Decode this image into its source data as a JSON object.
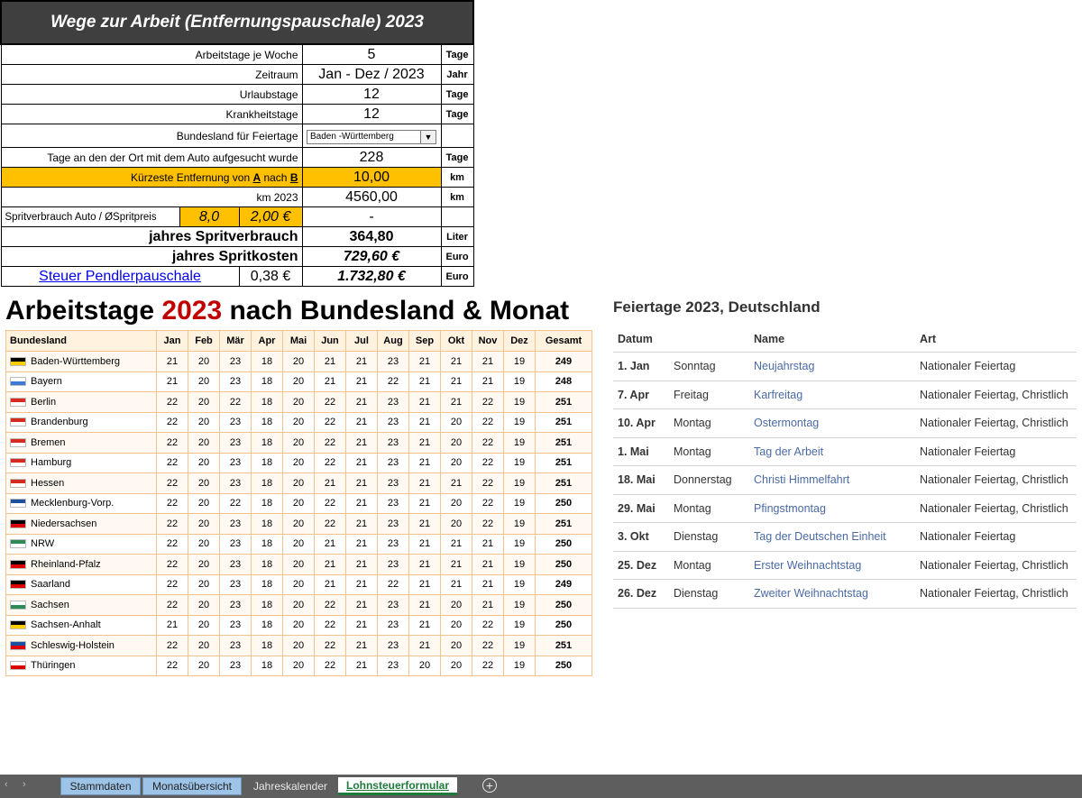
{
  "calc": {
    "title": "Wege zur Arbeit  (Entfernungspauschale)  2023",
    "rows": [
      {
        "label": "Arbeitstage je Woche",
        "value": "5",
        "unit": "Tage"
      },
      {
        "label": "Zeitraum",
        "value": "Jan - Dez / 2023",
        "unit": "Jahr"
      },
      {
        "label": "Urlaubstage",
        "value": "12",
        "unit": "Tage"
      },
      {
        "label": "Krankheitstage",
        "value": "12",
        "unit": "Tage"
      },
      {
        "label": "Bundesland für Feiertage",
        "value": "Baden -Württemberg",
        "unit": ""
      },
      {
        "label": "Tage an den der Ort mit dem Auto aufgesucht wurde",
        "value": "228",
        "unit": "Tage"
      },
      {
        "label_pre": "Kürzeste Entfernung von ",
        "label_a": "A",
        "label_mid": " nach ",
        "label_b": "B",
        "value": "10,00",
        "unit": "km"
      },
      {
        "label": "km 2023",
        "value": "4560,00",
        "unit": "km"
      }
    ],
    "sprit": {
      "label": "Spritverbrauch Auto / ØSpritpreis",
      "verbrauch": "8,0",
      "preis": "2,00 €",
      "value": "-"
    },
    "liter": {
      "label": "jahres Spritverbrauch",
      "value": "364,80",
      "unit": "Liter"
    },
    "kosten": {
      "label": "jahres Spritkosten",
      "value": "729,60 €",
      "unit": "Euro"
    },
    "pendler": {
      "label": "Steuer Pendlerpauschale",
      "rate": "0,38 €",
      "value": "1.732,80 €",
      "unit": "Euro"
    }
  },
  "arbeitstage": {
    "title_pre": "Arbeitstage ",
    "title_year": "2023",
    "title_post": " nach Bundesland & Monat",
    "headers": [
      "Bundesland",
      "Jan",
      "Feb",
      "Mär",
      "Apr",
      "Mai",
      "Jun",
      "Jul",
      "Aug",
      "Sep",
      "Okt",
      "Nov",
      "Dez",
      "Gesamt"
    ],
    "rows": [
      {
        "state": "Baden-Württemberg",
        "flag": [
          "#000000",
          "#ffcc00"
        ],
        "v": [
          "21",
          "20",
          "23",
          "18",
          "20",
          "21",
          "21",
          "23",
          "21",
          "21",
          "21",
          "19",
          "249"
        ]
      },
      {
        "state": "Bayern",
        "flag": [
          "#ffffff",
          "#3a7bd5"
        ],
        "v": [
          "21",
          "20",
          "23",
          "18",
          "20",
          "21",
          "21",
          "22",
          "21",
          "21",
          "21",
          "19",
          "248"
        ]
      },
      {
        "state": "Berlin",
        "flag": [
          "#d52b1e",
          "#ffffff"
        ],
        "v": [
          "22",
          "20",
          "22",
          "18",
          "20",
          "22",
          "21",
          "23",
          "21",
          "21",
          "22",
          "19",
          "251"
        ]
      },
      {
        "state": "Brandenburg",
        "flag": [
          "#d52b1e",
          "#ffffff"
        ],
        "v": [
          "22",
          "20",
          "23",
          "18",
          "20",
          "22",
          "21",
          "23",
          "21",
          "20",
          "22",
          "19",
          "251"
        ]
      },
      {
        "state": "Bremen",
        "flag": [
          "#d52b1e",
          "#ffffff"
        ],
        "v": [
          "22",
          "20",
          "23",
          "18",
          "20",
          "22",
          "21",
          "23",
          "21",
          "20",
          "22",
          "19",
          "251"
        ]
      },
      {
        "state": "Hamburg",
        "flag": [
          "#d52b1e",
          "#ffffff"
        ],
        "v": [
          "22",
          "20",
          "23",
          "18",
          "20",
          "22",
          "21",
          "23",
          "21",
          "20",
          "22",
          "19",
          "251"
        ]
      },
      {
        "state": "Hessen",
        "flag": [
          "#d52b1e",
          "#ffffff"
        ],
        "v": [
          "22",
          "20",
          "23",
          "18",
          "20",
          "21",
          "21",
          "23",
          "21",
          "21",
          "22",
          "19",
          "251"
        ]
      },
      {
        "state": "Mecklenburg-Vorp.",
        "flag": [
          "#1b4fa0",
          "#ffffff"
        ],
        "v": [
          "22",
          "20",
          "22",
          "18",
          "20",
          "22",
          "21",
          "23",
          "21",
          "20",
          "22",
          "19",
          "250"
        ]
      },
      {
        "state": "Niedersachsen",
        "flag": [
          "#000000",
          "#dd0000"
        ],
        "v": [
          "22",
          "20",
          "23",
          "18",
          "20",
          "22",
          "21",
          "23",
          "21",
          "20",
          "22",
          "19",
          "251"
        ]
      },
      {
        "state": "NRW",
        "flag": [
          "#2e8b57",
          "#ffffff"
        ],
        "v": [
          "22",
          "20",
          "23",
          "18",
          "20",
          "21",
          "21",
          "23",
          "21",
          "21",
          "21",
          "19",
          "250"
        ]
      },
      {
        "state": "Rheinland-Pfalz",
        "flag": [
          "#000000",
          "#dd0000"
        ],
        "v": [
          "22",
          "20",
          "23",
          "18",
          "20",
          "21",
          "21",
          "23",
          "21",
          "21",
          "21",
          "19",
          "250"
        ]
      },
      {
        "state": "Saarland",
        "flag": [
          "#000000",
          "#dd0000"
        ],
        "v": [
          "22",
          "20",
          "23",
          "18",
          "20",
          "21",
          "21",
          "22",
          "21",
          "21",
          "21",
          "19",
          "249"
        ]
      },
      {
        "state": "Sachsen",
        "flag": [
          "#ffffff",
          "#2e8b57"
        ],
        "v": [
          "22",
          "20",
          "23",
          "18",
          "20",
          "22",
          "21",
          "23",
          "21",
          "20",
          "21",
          "19",
          "250"
        ]
      },
      {
        "state": "Sachsen-Anhalt",
        "flag": [
          "#000000",
          "#ffcc00"
        ],
        "v": [
          "21",
          "20",
          "23",
          "18",
          "20",
          "22",
          "21",
          "23",
          "21",
          "20",
          "22",
          "19",
          "250"
        ]
      },
      {
        "state": "Schleswig-Holstein",
        "flag": [
          "#1b4fa0",
          "#dd0000"
        ],
        "v": [
          "22",
          "20",
          "23",
          "18",
          "20",
          "22",
          "21",
          "23",
          "21",
          "20",
          "22",
          "19",
          "251"
        ]
      },
      {
        "state": "Thüringen",
        "flag": [
          "#ffffff",
          "#dd0000"
        ],
        "v": [
          "22",
          "20",
          "23",
          "18",
          "20",
          "22",
          "21",
          "23",
          "20",
          "20",
          "22",
          "19",
          "250"
        ]
      }
    ]
  },
  "feiertage": {
    "title": "Feiertage 2023, Deutschland",
    "headers": [
      "Datum",
      "",
      "Name",
      "Art"
    ],
    "rows": [
      {
        "datum": "1. Jan",
        "tag": "Sonntag",
        "name": "Neujahrstag",
        "art": "Nationaler Feiertag"
      },
      {
        "datum": "7. Apr",
        "tag": "Freitag",
        "name": "Karfreitag",
        "art": "Nationaler Feiertag, Christlich"
      },
      {
        "datum": "10. Apr",
        "tag": "Montag",
        "name": "Ostermontag",
        "art": "Nationaler Feiertag, Christlich"
      },
      {
        "datum": "1. Mai",
        "tag": "Montag",
        "name": "Tag der Arbeit",
        "art": "Nationaler Feiertag"
      },
      {
        "datum": "18. Mai",
        "tag": "Donnerstag",
        "name": "Christi Himmelfahrt",
        "art": "Nationaler Feiertag, Christlich"
      },
      {
        "datum": "29. Mai",
        "tag": "Montag",
        "name": "Pfingstmontag",
        "art": "Nationaler Feiertag, Christlich"
      },
      {
        "datum": "3. Okt",
        "tag": "Dienstag",
        "name": "Tag der Deutschen Einheit",
        "art": "Nationaler Feiertag"
      },
      {
        "datum": "25. Dez",
        "tag": "Montag",
        "name": "Erster Weihnachtstag",
        "art": "Nationaler Feiertag, Christlich"
      },
      {
        "datum": "26. Dez",
        "tag": "Dienstag",
        "name": "Zweiter Weihnachtstag",
        "art": "Nationaler Feiertag, Christlich"
      }
    ]
  },
  "tabs": {
    "prev": "‹",
    "next": "›",
    "items": [
      "Stammdaten",
      "Monatsübersicht",
      "Jahreskalender",
      "Lohnsteuerformular"
    ],
    "add": "+"
  }
}
